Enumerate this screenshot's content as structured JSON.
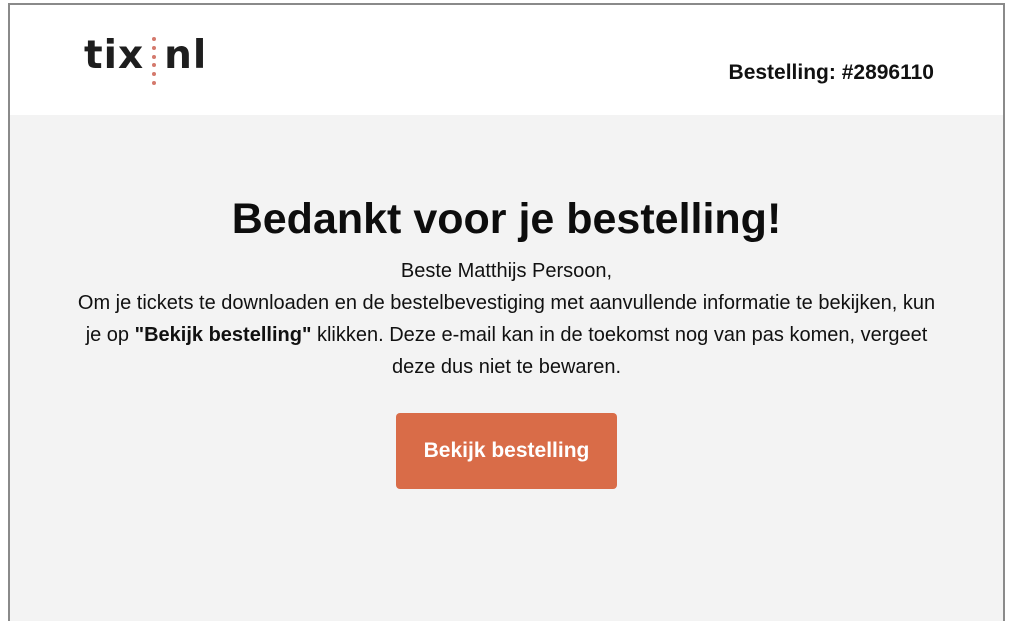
{
  "header": {
    "logo": {
      "left": "tix",
      "right": "nl",
      "separator_color": "#d4796c"
    },
    "order_label": "Bestelling: #2896110"
  },
  "main": {
    "title": "Bedankt voor je bestelling!",
    "greeting": "Beste Matthijs Persoon,",
    "message_before": "Om je tickets te downloaden en de bestelbevestiging met aanvullende informatie te bekijken, kun je op ",
    "message_highlight": "\"Bekijk bestelling\"",
    "message_after": " klikken. Deze e-mail kan in de toekomst nog van pas komen, vergeet deze dus niet te bewaren.",
    "button_label": "Bekijk bestelling"
  },
  "colors": {
    "accent": "#d96c48",
    "content_background": "#f3f3f3",
    "header_background": "#ffffff"
  }
}
